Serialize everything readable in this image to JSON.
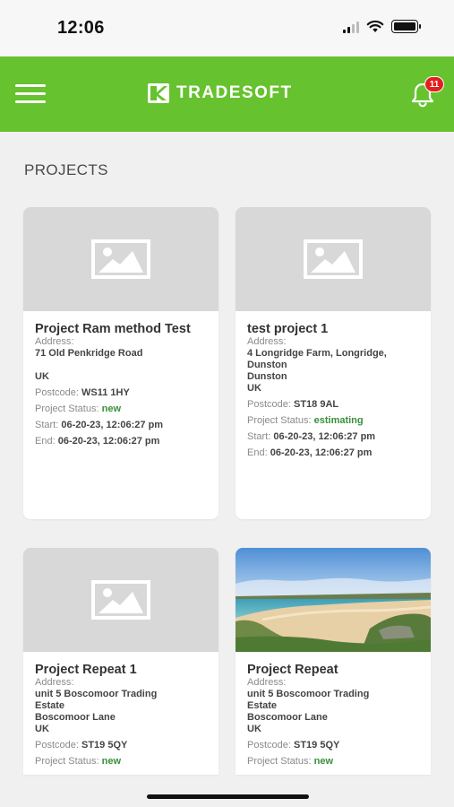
{
  "status_bar": {
    "time": "12:06"
  },
  "app_bar": {
    "brand": "TRADESOFT",
    "notification_count": "11"
  },
  "section_title": "PROJECTS",
  "labels": {
    "address": "Address:",
    "postcode": "Postcode:",
    "status": "Project Status:",
    "start": "Start:",
    "end": "End:"
  },
  "projects": [
    {
      "title": "Project Ram method Test",
      "address_lines": [
        "71 Old Penkridge Road",
        "",
        "UK"
      ],
      "postcode": "WS11 1HY",
      "status": "new",
      "start": "06-20-23, 12:06:27 pm",
      "end": "06-20-23, 12:06:27 pm",
      "image": "placeholder-image-icon"
    },
    {
      "title": "test project 1",
      "address_lines": [
        "4 Longridge Farm, Longridge,",
        "Dunston",
        "Dunston",
        "UK"
      ],
      "postcode": "ST18 9AL",
      "status": "estimating",
      "start": "06-20-23, 12:06:27 pm",
      "end": "06-20-23, 12:06:27 pm",
      "image": "placeholder-image-icon"
    },
    {
      "title": "Project Repeat 1",
      "address_lines": [
        "unit 5 Boscomoor Trading",
        "Estate",
        "Boscomoor Lane",
        "UK"
      ],
      "postcode": "ST19 5QY",
      "status": "new",
      "image": "placeholder-image-icon"
    },
    {
      "title": "Project Repeat",
      "address_lines": [
        "unit 5 Boscomoor Trading",
        "Estate",
        "Boscomoor Lane",
        "UK"
      ],
      "postcode": "ST19 5QY",
      "status": "new",
      "image": "beach-photo"
    }
  ],
  "colors": {
    "brand_green": "#66c22e",
    "status_green": "#3a8f3a",
    "badge_red": "#e02020"
  }
}
